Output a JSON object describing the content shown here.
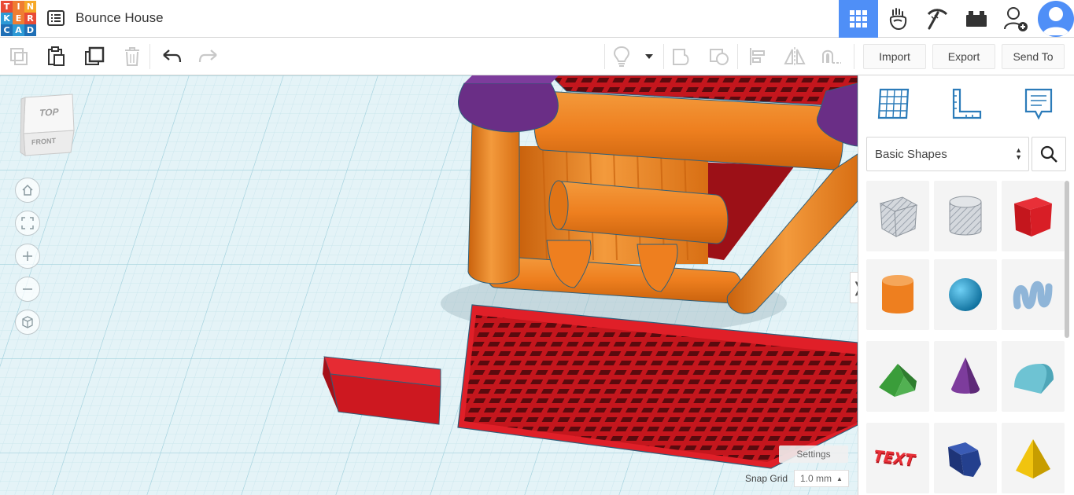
{
  "app": {
    "logo_letters": [
      "T",
      "I",
      "N",
      "K",
      "E",
      "R",
      "C",
      "A",
      "D"
    ],
    "logo_colors": [
      "#e94b35",
      "#ef7d32",
      "#f6a929",
      "#2d9ad6",
      "#ef7d32",
      "#e94b35",
      "#1f6fb6",
      "#2d9ad6",
      "#1f6fb6"
    ],
    "design_title": "Bounce House"
  },
  "topbar": {
    "buttons": [
      {
        "name": "3d-design-view",
        "icon": "grid-icon",
        "active": true
      },
      {
        "name": "blocks-view",
        "icon": "hand-icon"
      },
      {
        "name": "bricks-view",
        "icon": "pickaxe-icon"
      },
      {
        "name": "lego-view",
        "icon": "brick-icon"
      },
      {
        "name": "invite-collaborators",
        "icon": "add-user-icon"
      }
    ]
  },
  "toolbar": {
    "copy_icon": "copy-icon",
    "paste_icon": "paste-icon",
    "duplicate_icon": "duplicate-icon",
    "delete_icon": "trash-icon",
    "undo_icon": "undo-icon",
    "redo_icon": "redo-icon",
    "note_icon": "lightbulb-icon",
    "group_icon": "group-icon",
    "ungroup_icon": "ungroup-icon",
    "align_icon": "align-icon",
    "mirror_icon": "mirror-icon",
    "magnet_icon": "magnet-icon",
    "import_label": "Import",
    "export_label": "Export",
    "send_to_label": "Send To"
  },
  "workplane": {
    "viewcube_top": "TOP",
    "viewcube_front": "FRONT",
    "settings_label": "Settings",
    "snap_grid_label": "Snap Grid",
    "snap_grid_value": "1.0 mm",
    "collapse_label": "❭"
  },
  "panel": {
    "library_selected": "Basic Shapes",
    "shapes": [
      {
        "name": "box-hole",
        "color": "#b9bfc6"
      },
      {
        "name": "cylinder-hole",
        "color": "#c9cdd2"
      },
      {
        "name": "box",
        "color": "#d81e26"
      },
      {
        "name": "cylinder",
        "color": "#ee7f1f"
      },
      {
        "name": "sphere",
        "color": "#1a8fc7"
      },
      {
        "name": "scribble",
        "color": "#8fb5d8"
      },
      {
        "name": "roof",
        "color": "#3a9d3a"
      },
      {
        "name": "cone",
        "color": "#7d3c9c"
      },
      {
        "name": "round-roof",
        "color": "#6ec3d3"
      },
      {
        "name": "text",
        "color": "#d81e26"
      },
      {
        "name": "polygon-prism",
        "color": "#24408e"
      },
      {
        "name": "pyramid",
        "color": "#f1c40f"
      }
    ]
  },
  "colors": {
    "accent": "#4f8ff7",
    "workplane": "#e4f3f7",
    "grid_line": "#bfe0ea",
    "orange": "#ee7f1f",
    "red": "#d81e26",
    "purple": "#6a2e86"
  }
}
